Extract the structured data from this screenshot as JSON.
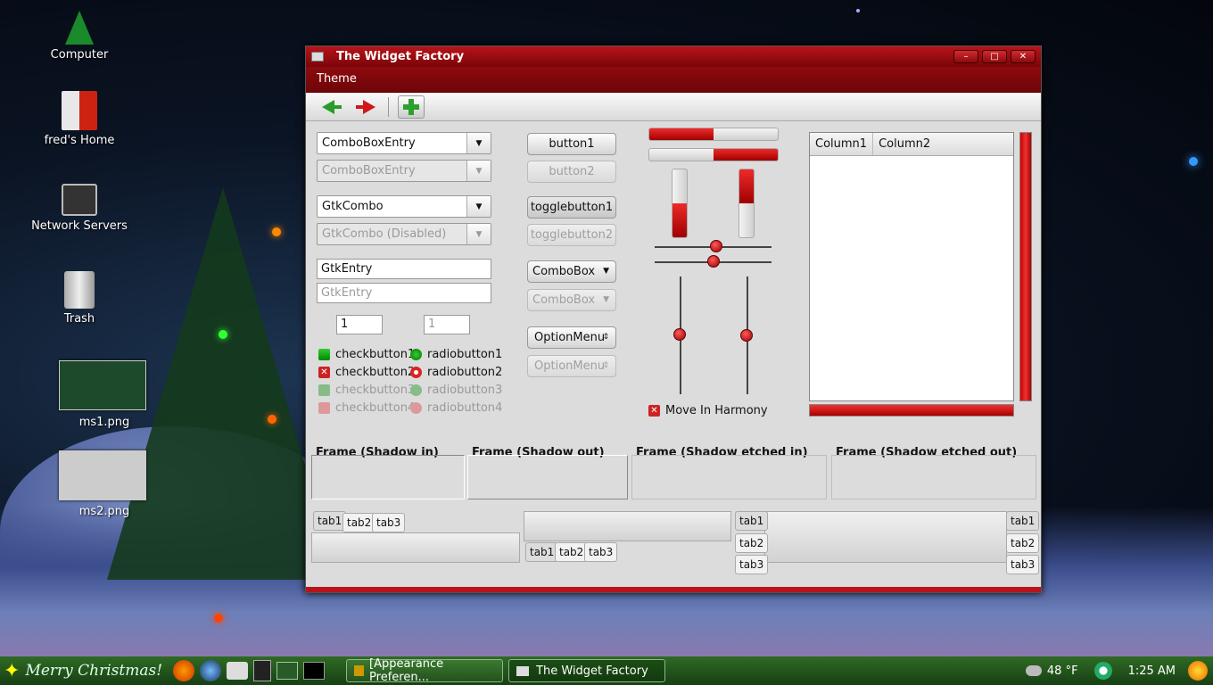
{
  "desktop": {
    "icons": [
      {
        "label": "Computer",
        "icon": "christmas-tree-icon"
      },
      {
        "label": "fred's Home",
        "icon": "home-icon"
      },
      {
        "label": "Network Servers",
        "icon": "network-icon"
      },
      {
        "label": "Trash",
        "icon": "trash-icon"
      },
      {
        "label": "ms1.png",
        "icon": "image-thumbnail"
      },
      {
        "label": "ms2.png",
        "icon": "image-thumbnail"
      }
    ]
  },
  "window": {
    "title": "The Widget Factory",
    "menu": "Theme",
    "controls": [
      "minimize",
      "maximize",
      "close"
    ]
  },
  "toolbar": {
    "icons": [
      "back-arrow-icon",
      "forward-arrow-icon",
      "add-icon"
    ]
  },
  "col1": {
    "combo1": "ComboBoxEntry",
    "combo2": "ComboBoxEntry",
    "gtkcombo": "GtkCombo",
    "gtkcombo_dis": "GtkCombo (Disabled)",
    "entry": "GtkEntry",
    "entry_dis": "GtkEntry",
    "spin1": "1",
    "spin2": "1",
    "checks": [
      "checkbutton1",
      "checkbutton2",
      "checkbutton3",
      "checkbutton4"
    ],
    "radios": [
      "radiobutton1",
      "radiobutton2",
      "radiobutton3",
      "radiobutton4"
    ]
  },
  "col2": {
    "button1": "button1",
    "button2": "button2",
    "toggle1": "togglebutton1",
    "toggle2": "togglebutton2",
    "combobox1": "ComboBox",
    "combobox2": "ComboBox",
    "option1": "OptionMenu",
    "option2": "OptionMenu"
  },
  "col3": {
    "progress_h1": 0.5,
    "progress_h2": 0.5,
    "progress_v1": 0.5,
    "progress_v2": 0.5,
    "harmony": "Move In Harmony"
  },
  "tree": {
    "columns": [
      "Column1",
      "Column2"
    ]
  },
  "frames": [
    "Frame (Shadow in)",
    "Frame (Shadow out)",
    "Frame (Shadow etched in)",
    "Frame (Shadow etched out)"
  ],
  "tabs": [
    "tab1",
    "tab2",
    "tab3"
  ],
  "taskbar": {
    "greeting": "Merry Christmas!",
    "tasks": [
      "[Appearance Preferen...",
      "The Widget Factory"
    ],
    "weather": "48 °F",
    "clock": "1:25 AM"
  },
  "colors": {
    "accent": "#b8141a",
    "taskbar": "#2f6b24"
  }
}
